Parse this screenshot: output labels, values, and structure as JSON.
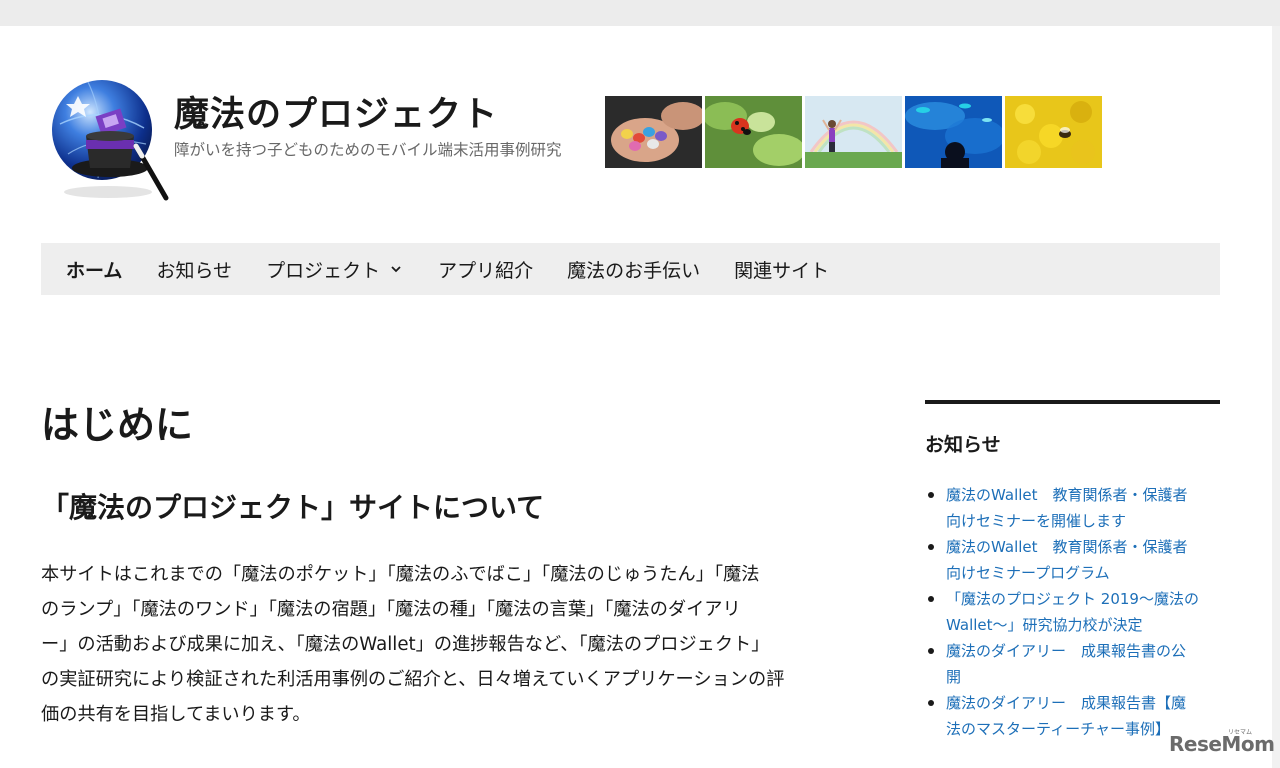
{
  "site": {
    "title": "魔法のプロジェクト",
    "description": "障がいを持つ子どものためのモバイル端末活用事例研究"
  },
  "header_images": [
    {
      "icon": "hands-with-candies-photo"
    },
    {
      "icon": "ladybug-photo"
    },
    {
      "icon": "child-with-rainbow-photo"
    },
    {
      "icon": "aquarium-silhouette-photo"
    },
    {
      "icon": "bee-on-flowers-photo"
    }
  ],
  "nav": {
    "items": [
      {
        "label": "ホーム",
        "active": true
      },
      {
        "label": "お知らせ"
      },
      {
        "label": "プロジェクト",
        "has_dropdown": true
      },
      {
        "label": "アプリ紹介"
      },
      {
        "label": "魔法のお手伝い"
      },
      {
        "label": "関連サイト"
      }
    ]
  },
  "main": {
    "page_title": "はじめに",
    "section_title": "「魔法のプロジェクト」サイトについて",
    "body_lines": [
      "本サイトはこれまでの「魔法のポケット」「魔法のふでばこ」「魔法のじゅうたん」「魔法",
      "のランプ」「魔法のワンド」「魔法の宿題」「魔法の種」「魔法の言葉」「魔法のダイアリ",
      "ー」の活動および成果に加え、「魔法のWallet」の進捗報告など、「魔法のプロジェクト」",
      "の実証研究により検証された利活用事例のご紹介と、日々増えていくアプリケーションの評",
      "価の共有を目指してまいります。"
    ]
  },
  "sidebar": {
    "title": "お知らせ",
    "items": [
      {
        "lines": [
          "魔法のWallet　教育関係者・保護者",
          "向けセミナーを開催します"
        ]
      },
      {
        "lines": [
          "魔法のWallet　教育関係者・保護者",
          "向けセミナープログラム"
        ]
      },
      {
        "lines": [
          "「魔法のプロジェクト 2019～魔法の",
          "Wallet～」研究協力校が決定"
        ]
      },
      {
        "lines": [
          "魔法のダイアリー　成果報告書の公",
          "開"
        ]
      },
      {
        "lines": [
          "魔法のダイアリー　成果報告書【魔",
          "法のマスターティーチャー事例】"
        ]
      }
    ]
  },
  "watermark": {
    "text": "ReseMom",
    "tag": "リセマム"
  },
  "colors": {
    "link": "#1d6fb8",
    "nav_bg": "#eeeeee",
    "top_band": "#ececec",
    "text": "#1a1a1a",
    "muted": "#686868"
  }
}
